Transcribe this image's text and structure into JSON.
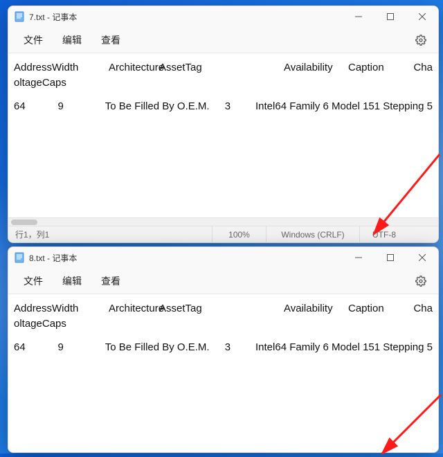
{
  "app_name": "记事本",
  "windows": [
    {
      "filename": "7.txt",
      "title_sep": " - "
    },
    {
      "filename": "8.txt",
      "title_sep": " - "
    }
  ],
  "menubar": {
    "file": "文件",
    "edit": "编辑",
    "view": "查看"
  },
  "content": {
    "headers": {
      "addressWidth": "AddressWidth",
      "architecture": "Architecture",
      "assetTag": "AssetTag",
      "availability": "Availability",
      "caption": "Caption",
      "cha_partial": "Cha",
      "oltageCaps": "oltageCaps"
    },
    "row": {
      "addressWidth": "64",
      "architecture": "9",
      "assetTag": "To Be Filled By O.E.M.",
      "availability": "3",
      "caption": "Intel64 Family 6 Model 151 Stepping 5"
    }
  },
  "statusbar": {
    "line_col": "行1，列1",
    "zoom": "100%",
    "line_ending": "Windows (CRLF)",
    "encoding": "UTF-8"
  }
}
